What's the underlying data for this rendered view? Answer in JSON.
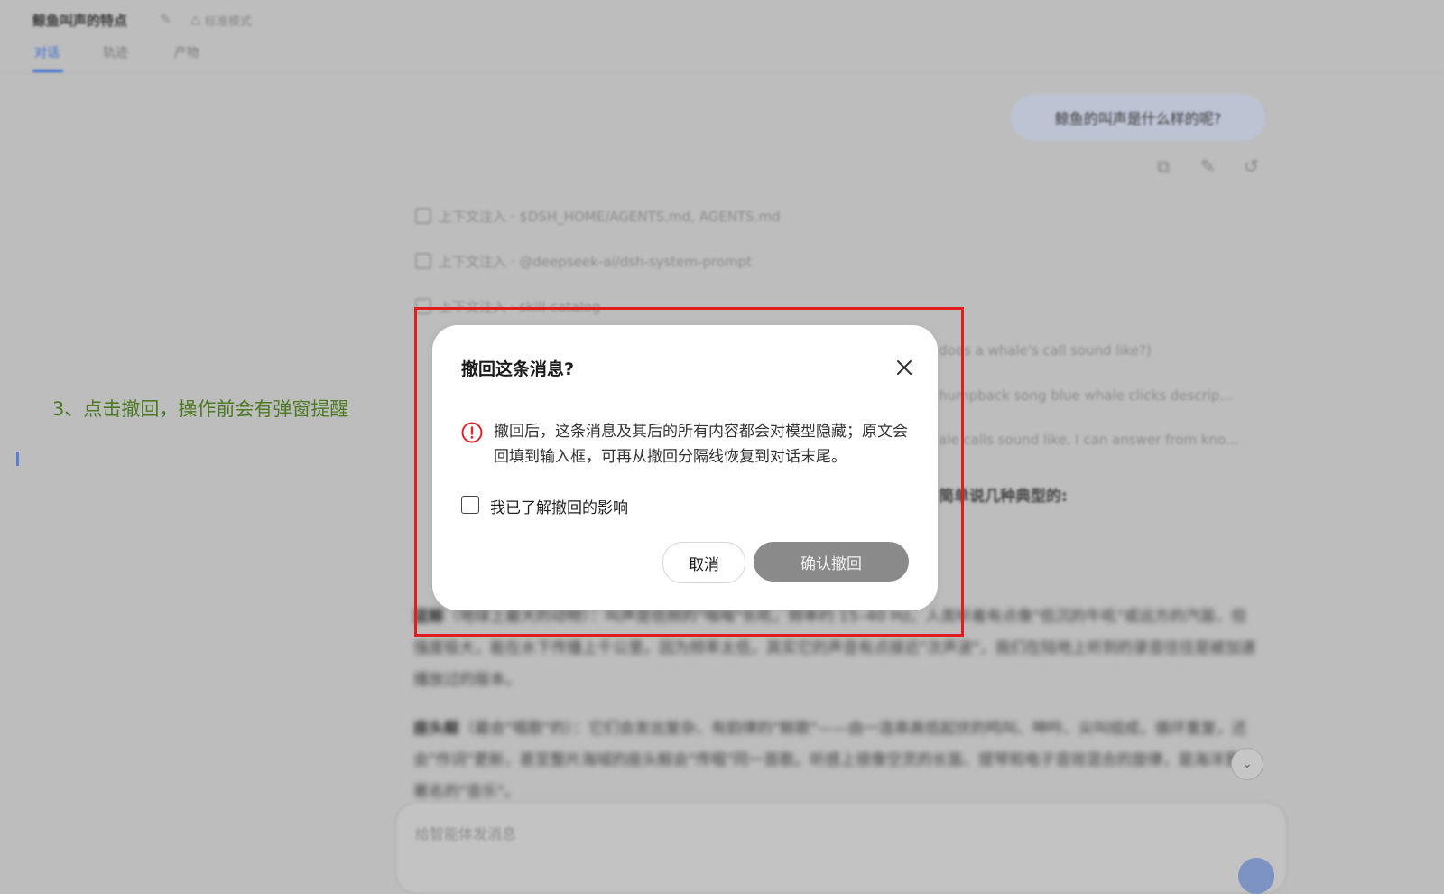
{
  "header": {
    "title": "鲸鱼叫声的特点",
    "mode_label": "标准模式",
    "tabs": [
      {
        "label": "对话"
      },
      {
        "label": "轨迹"
      },
      {
        "label": "产物"
      }
    ]
  },
  "conversation": {
    "user_message": "鲸鱼的叫声是什么样的呢?",
    "context_rows": [
      {
        "label": "上下文注入",
        "value": "$DSH_HOME/AGENTS.md, AGENTS.md"
      },
      {
        "label": "上下文注入",
        "value": "@deepseek-ai/dsh-system-prompt"
      },
      {
        "label": "上下文注入",
        "value": "skill-catalog"
      }
    ],
    "side_snippets": [
      "does a whale's call sound like?)",
      "humpback song blue whale clicks descrip...",
      "ale calls sound like. I can answer from kno..."
    ],
    "answer_heading_tail": "简单说几种典型的:",
    "paragraphs": [
      {
        "bold": "蓝鲸",
        "text": "（地球上最大的动物）：叫声是低频的\"嗡嗡\"长吼，频率约 15–40 Hz。人类听着有点像\"低沉的牛吼\"或远方的汽笛，但强度极大，能在水下传播上千公里。因为频率太低，其实它的声音有点接近\"次声波\"，我们在陆地上听到的录音往往是被加速播放过的版本。"
      },
      {
        "bold": "座头鲸",
        "text": "（最会\"唱歌\"的）：它们会发出复杂、有韵律的\"鲸歌\"——由一连串高低起伏的鸣叫、呻吟、尖叫组成，循环重复，还会\"作词\"更新，甚至整片海域的座头鲸会\"传唱\"同一首歌。听感上很像空灵的长笛、提琴和电子音效混合的旋律，是海洋里最著名的\"音乐\"。"
      }
    ],
    "input_placeholder": "给智能体发消息"
  },
  "annotation": {
    "text": "3、点击撤回，操作前会有弹窗提醒",
    "color": "#4c7a25"
  },
  "highlight": {
    "color": "#e21d1d"
  },
  "dialog": {
    "title": "撤回这条消息?",
    "warning": "撤回后，这条消息及其后的所有内容都会对模型隐藏；原文会回填到输入框，可再从撤回分隔线恢复到对话末尾。",
    "checkbox_label": "我已了解撤回的影响",
    "checkbox_checked": false,
    "cancel_label": "取消",
    "confirm_label": "确认撤回",
    "warning_color": "#e0262b"
  }
}
